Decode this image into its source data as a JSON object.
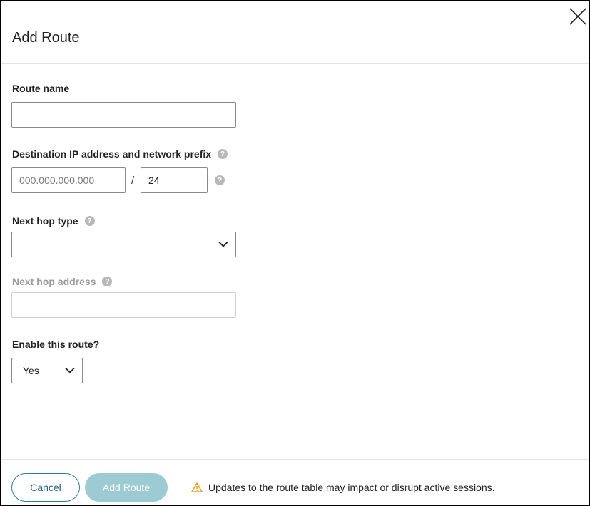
{
  "dialog": {
    "title": "Add Route"
  },
  "form": {
    "route_name": {
      "label": "Route name",
      "value": ""
    },
    "destination": {
      "label": "Destination IP address and network prefix",
      "ip_placeholder": "000.000.000.000",
      "ip_value": "",
      "separator": "/",
      "prefix_value": "24"
    },
    "next_hop_type": {
      "label": "Next hop type",
      "selected": ""
    },
    "next_hop_address": {
      "label": "Next hop address",
      "value": ""
    },
    "enable_route": {
      "label": "Enable this route?",
      "selected": "Yes"
    }
  },
  "help_glyph": "?",
  "footer": {
    "cancel_label": "Cancel",
    "add_label": "Add Route",
    "warning_text": "Updates to the route table may impact or disrupt active sessions."
  },
  "colors": {
    "accent": "#2d7f8e",
    "primary_disabled": "#9ccbd3",
    "warning": "#e8a317"
  }
}
